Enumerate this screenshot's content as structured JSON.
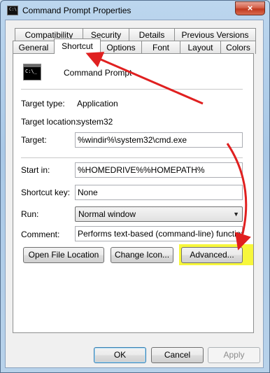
{
  "window": {
    "title": "Command Prompt Properties",
    "close_label": "×"
  },
  "tabs": {
    "row1": [
      "Compatibility",
      "Security",
      "Details",
      "Previous Versions"
    ],
    "row2": [
      "General",
      "Shortcut",
      "Options",
      "Font",
      "Layout",
      "Colors"
    ],
    "active": "Shortcut"
  },
  "shortcut": {
    "icon_text": "C:\\_",
    "name": "Command Prompt",
    "target_type_label": "Target type:",
    "target_type_value": "Application",
    "target_location_label": "Target location:",
    "target_location_value": "system32",
    "target_label": "Target:",
    "target_value": "%windir%\\system32\\cmd.exe",
    "start_in_label": "Start in:",
    "start_in_value": "%HOMEDRIVE%%HOMEPATH%",
    "shortcut_key_label": "Shortcut key:",
    "shortcut_key_value": "None",
    "run_label": "Run:",
    "run_value": "Normal window",
    "comment_label": "Comment:",
    "comment_value": "Performs text-based (command-line) functions.",
    "open_file_location": "Open File Location",
    "change_icon": "Change Icon...",
    "advanced": "Advanced..."
  },
  "footer": {
    "ok": "OK",
    "cancel": "Cancel",
    "apply": "Apply"
  },
  "colors": {
    "highlight": "#f6f62a",
    "annotation_arrow": "#e02020"
  }
}
